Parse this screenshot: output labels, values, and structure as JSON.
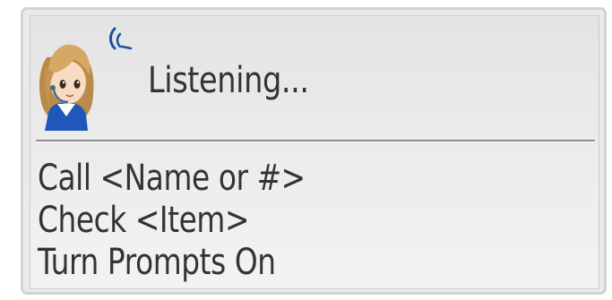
{
  "dialog": {
    "status": "Listening...",
    "avatar_icon": "assistant-avatar-icon",
    "voice_icon": "voice-wave-icon",
    "accent_color": "#1a4fa3"
  },
  "commands": [
    {
      "label": "Call <Name or #>"
    },
    {
      "label": "Check <Item>"
    },
    {
      "label": "Turn Prompts On"
    }
  ]
}
